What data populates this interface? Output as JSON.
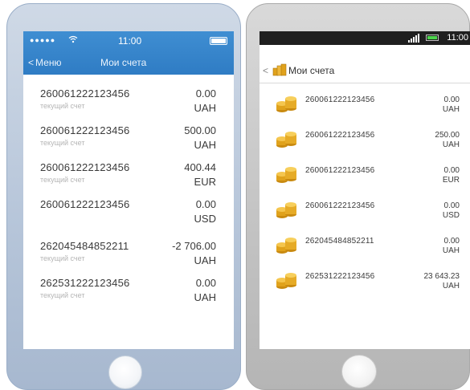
{
  "ios": {
    "status": {
      "signal": "●●●●●",
      "wifi_icon": "wifi-icon",
      "time": "11:00"
    },
    "nav": {
      "back_label": "Меню",
      "back_chevron": "<",
      "title": "Мои счета"
    },
    "accounts": [
      {
        "number": "260061222123456",
        "type": "текущий счет",
        "amount": "0.00",
        "currency": "UAH"
      },
      {
        "number": "260061222123456",
        "type": "текущий счет",
        "amount": "500.00",
        "currency": "UAH"
      },
      {
        "number": "260061222123456",
        "type": "текущий счет",
        "amount": "400.44",
        "currency": "EUR"
      },
      {
        "number": "260061222123456",
        "type": "",
        "amount": "0.00",
        "currency": "USD"
      },
      {
        "number": "262045484852211",
        "type": "текущий счет",
        "amount": "-2 706.00",
        "currency": "UAH"
      },
      {
        "number": "262531222123456",
        "type": "текущий счет",
        "amount": "0.00",
        "currency": "UAH"
      }
    ]
  },
  "android": {
    "status": {
      "time": "11:00"
    },
    "header": {
      "back_chevron": "<",
      "title": "Мои счета"
    },
    "accounts": [
      {
        "number": "260061222123456",
        "amount": "0.00",
        "currency": "UAH"
      },
      {
        "number": "260061222123456",
        "amount": "250.00",
        "currency": "UAH"
      },
      {
        "number": "260061222123456",
        "amount": "0.00",
        "currency": "EUR"
      },
      {
        "number": "260061222123456",
        "amount": "0.00",
        "currency": "USD"
      },
      {
        "number": "262045484852211",
        "amount": "0.00",
        "currency": "UAH"
      },
      {
        "number": "262531222123456",
        "amount": "23 643.23",
        "currency": "UAH"
      }
    ]
  },
  "colors": {
    "ios_bar": "#2f7cc4",
    "ios_frame": "#b7c6da",
    "android_frame": "#c4c4c4",
    "android_status": "#1f1f1f",
    "coin_gold": "#e0a21c",
    "battery_green": "#4cd44c"
  }
}
